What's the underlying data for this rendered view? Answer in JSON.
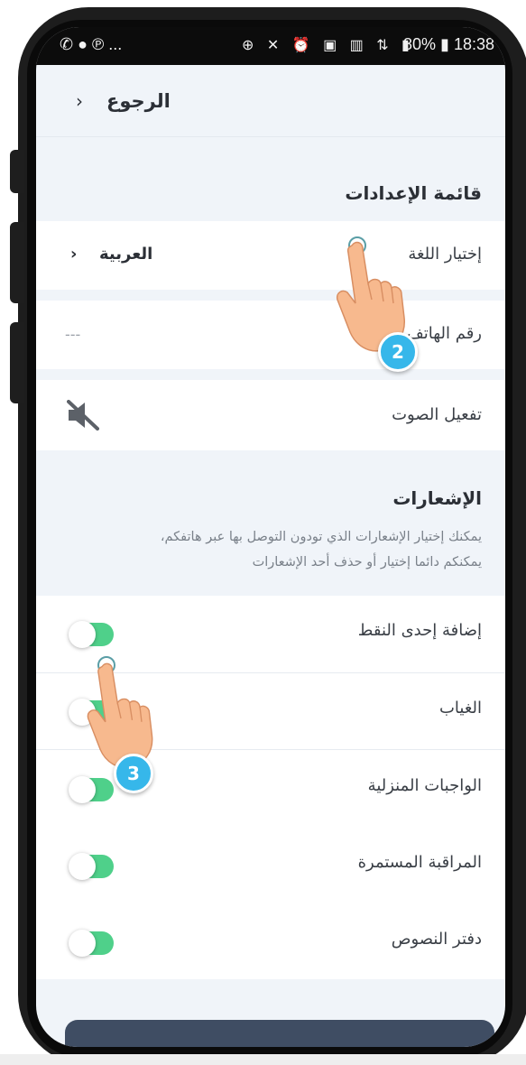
{
  "status_bar": {
    "left_icons": "✆ ● ℗ ...",
    "middle_icons": "⊕ ✕ ⏰ ▣ ▥ ⇅ ▮",
    "battery": "80%",
    "time": "18:38"
  },
  "header": {
    "back_label": "الرجوع",
    "chevron": "›"
  },
  "settings": {
    "title": "قائمة الإعدادات",
    "language_label": "إختيار اللغة",
    "language_value": "العربية",
    "language_chevron": "›",
    "phone_label": "رقم الهاتف",
    "phone_value": "---",
    "sound_label": "تفعيل الصوت",
    "sound_icon": "muted-speaker-icon"
  },
  "notifications": {
    "title": "الإشعارات",
    "description_line1": "يمكنك إختيار الإشعارات الذي تودون التوصل بها عبر هاتفكم،",
    "description_line2": "يمكنكم دائما إختيار أو حذف أحد الإشعارات",
    "items": [
      {
        "label": "إضافة إحدى النقط",
        "enabled": true
      },
      {
        "label": "الغياب",
        "enabled": true
      },
      {
        "label": "الواجبات المنزلية",
        "enabled": true
      },
      {
        "label": "المراقبة المستمرة",
        "enabled": true
      },
      {
        "label": "دفتر النصوص",
        "enabled": true
      }
    ]
  },
  "tutorial": {
    "step_a": "2",
    "step_b": "3"
  },
  "colors": {
    "toggle_on": "#4fd08a",
    "badge": "#36b7ea",
    "bottom_button": "#3f4d63"
  }
}
